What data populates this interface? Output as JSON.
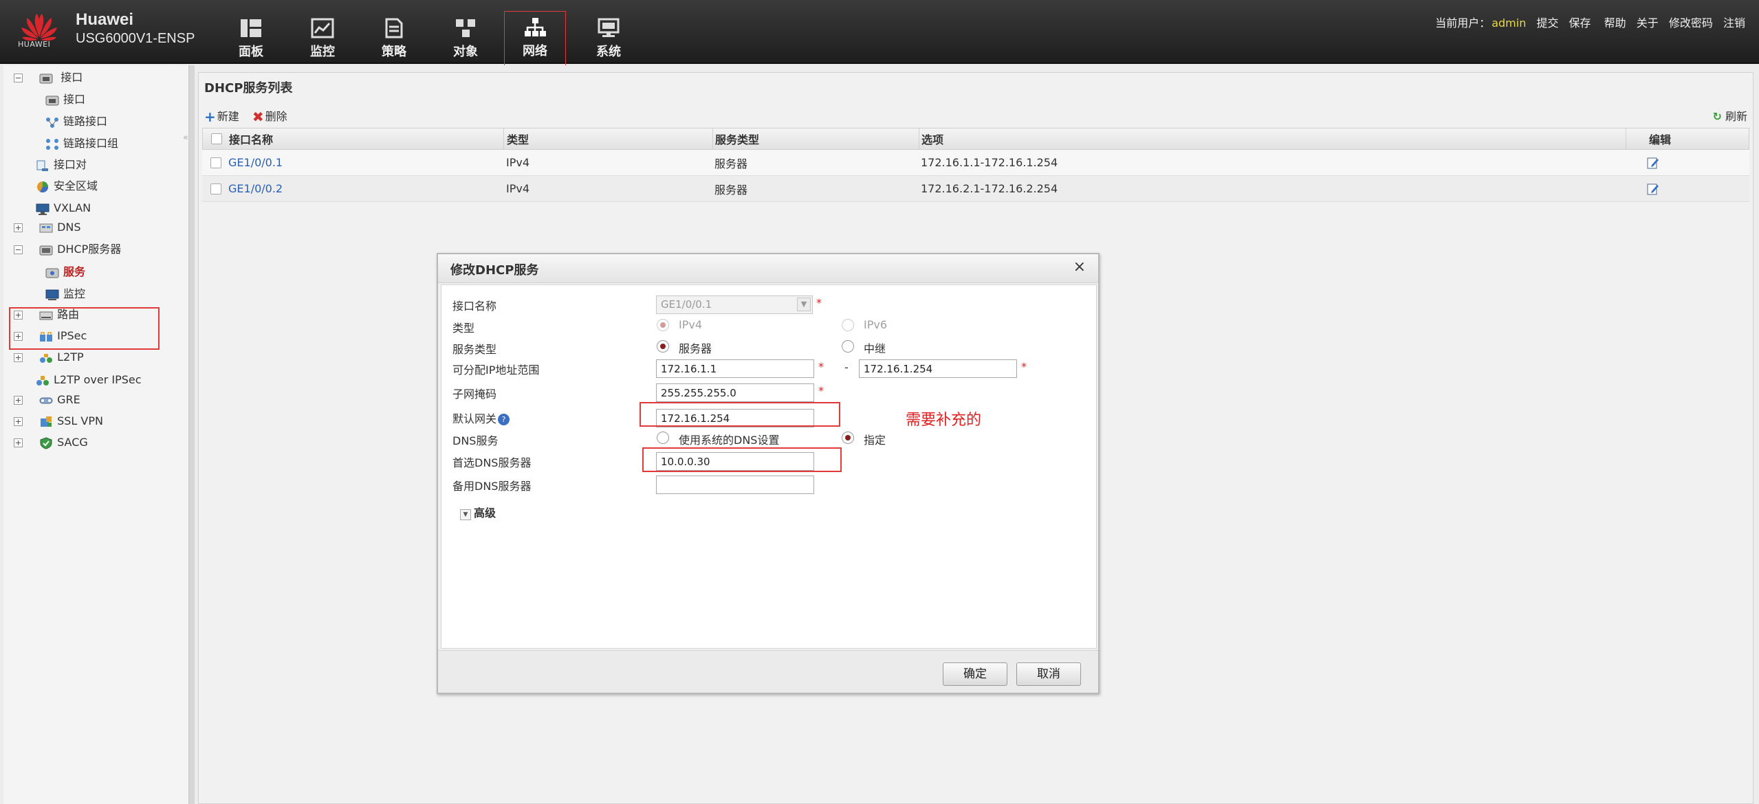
{
  "header": {
    "brand": "Huawei",
    "model": "USG6000V1-ENSP",
    "logo_text": "HUAWEI",
    "nav": [
      {
        "label": "面板",
        "icon": "dashboard-icon"
      },
      {
        "label": "监控",
        "icon": "monitor-icon"
      },
      {
        "label": "策略",
        "icon": "policy-icon"
      },
      {
        "label": "对象",
        "icon": "object-icon"
      },
      {
        "label": "网络",
        "icon": "network-icon",
        "active": true
      },
      {
        "label": "系统",
        "icon": "system-icon"
      }
    ],
    "user_prefix": "当前用户：",
    "user": "admin",
    "links": [
      "提交",
      "保存",
      "帮助",
      "关于",
      "修改密码",
      "注销"
    ]
  },
  "sidebar": {
    "items": [
      {
        "label": "接口",
        "level": 0,
        "toggle": "minus"
      },
      {
        "label": "接口",
        "level": 1
      },
      {
        "label": "链路接口",
        "level": 1
      },
      {
        "label": "链路接口组",
        "level": 1
      },
      {
        "label": "接口对",
        "level": 0
      },
      {
        "label": "安全区域",
        "level": 0
      },
      {
        "label": "VXLAN",
        "level": 0
      },
      {
        "label": "DNS",
        "level": 0,
        "toggle": "plus"
      },
      {
        "label": "DHCP服务器",
        "level": 0,
        "toggle": "minus"
      },
      {
        "label": "服务",
        "level": 1,
        "selected": true
      },
      {
        "label": "监控",
        "level": 1
      },
      {
        "label": "路由",
        "level": 0,
        "toggle": "plus"
      },
      {
        "label": "IPSec",
        "level": 0,
        "toggle": "plus"
      },
      {
        "label": "L2TP",
        "level": 0,
        "toggle": "plus"
      },
      {
        "label": "L2TP over IPSec",
        "level": 0
      },
      {
        "label": "GRE",
        "level": 0,
        "toggle": "plus"
      },
      {
        "label": "SSL VPN",
        "level": 0,
        "toggle": "plus"
      },
      {
        "label": "SACG",
        "level": 0,
        "toggle": "plus"
      }
    ]
  },
  "main": {
    "title": "DHCP服务列表",
    "toolbar": {
      "new": "新建",
      "delete": "删除",
      "refresh": "刷新"
    },
    "table": {
      "columns": [
        "接口名称",
        "类型",
        "服务类型",
        "选项",
        "编辑"
      ],
      "rows": [
        {
          "name": "GE1/0/0.1",
          "type": "IPv4",
          "service": "服务器",
          "option": "172.16.1.1-172.16.1.254"
        },
        {
          "name": "GE1/0/0.2",
          "type": "IPv4",
          "service": "服务器",
          "option": "172.16.2.1-172.16.2.254"
        }
      ]
    }
  },
  "dialog": {
    "title": "修改DHCP服务",
    "close": "×",
    "labels": {
      "interface": "接口名称",
      "type": "类型",
      "service_type": "服务类型",
      "ip_range": "可分配IP地址范围",
      "mask": "子网掩码",
      "gateway": "默认网关",
      "dns_service": "DNS服务",
      "primary_dns": "首选DNS服务器",
      "secondary_dns": "备用DNS服务器"
    },
    "values": {
      "interface": "GE1/0/0.1",
      "type_ipv4": "IPv4",
      "type_ipv6": "IPv6",
      "service_server": "服务器",
      "service_relay": "中继",
      "ip_start": "172.16.1.1",
      "range_sep": "-",
      "ip_end": "172.16.1.254",
      "mask": "255.255.255.0",
      "gateway": "172.16.1.254",
      "dns_system": "使用系统的DNS设置",
      "dns_specify": "指定",
      "primary_dns": "10.0.0.30",
      "secondary_dns": ""
    },
    "required_mark": "*",
    "help_mark": "?",
    "advanced": "高级",
    "annotation": "需要补充的",
    "buttons": {
      "ok": "确定",
      "cancel": "取消"
    }
  }
}
